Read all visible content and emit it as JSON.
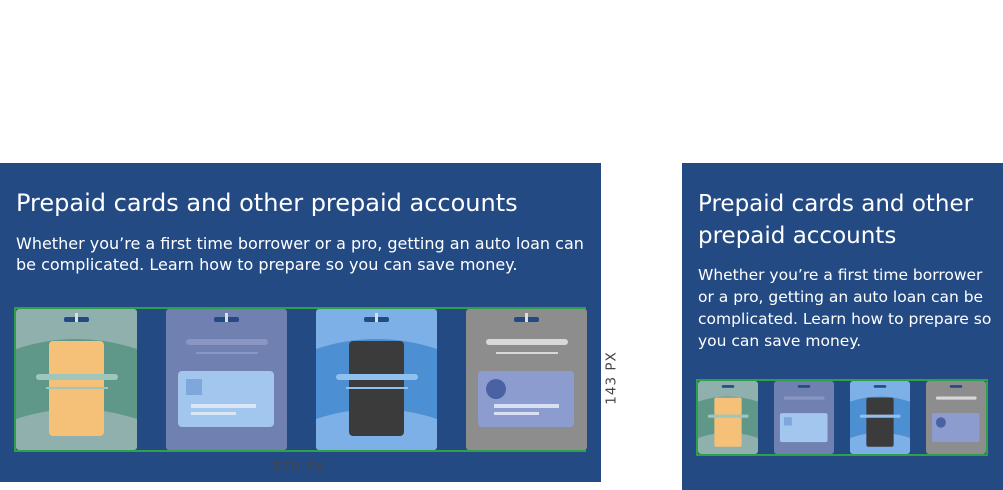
{
  "variants": {
    "large": {
      "title": "Prepaid cards and other prepaid accounts",
      "description": "Whether you’re a first time borrower or a pro, getting an auto loan can be complicated. Learn how to prepare so you can save money."
    },
    "small": {
      "title": "Prepaid cards and other prepaid accounts",
      "description": "Whether you’re a first time borrower or a pro, getting an auto loan can be complicated. Learn how to prepare so you can save money."
    }
  },
  "dimensions": {
    "width_label": "570 PX",
    "height_label": "143 PX"
  },
  "cards": [
    {
      "name": "gift-card",
      "bg": "#8fb0ac"
    },
    {
      "name": "payroll-card",
      "bg": "#6f80b1"
    },
    {
      "name": "debit-card",
      "bg": "#7db0e6"
    },
    {
      "name": "id-card",
      "bg": "#8d8d8d"
    }
  ],
  "colors": {
    "panel_bg": "#244a84",
    "highlight_border": "#2fa04a"
  }
}
